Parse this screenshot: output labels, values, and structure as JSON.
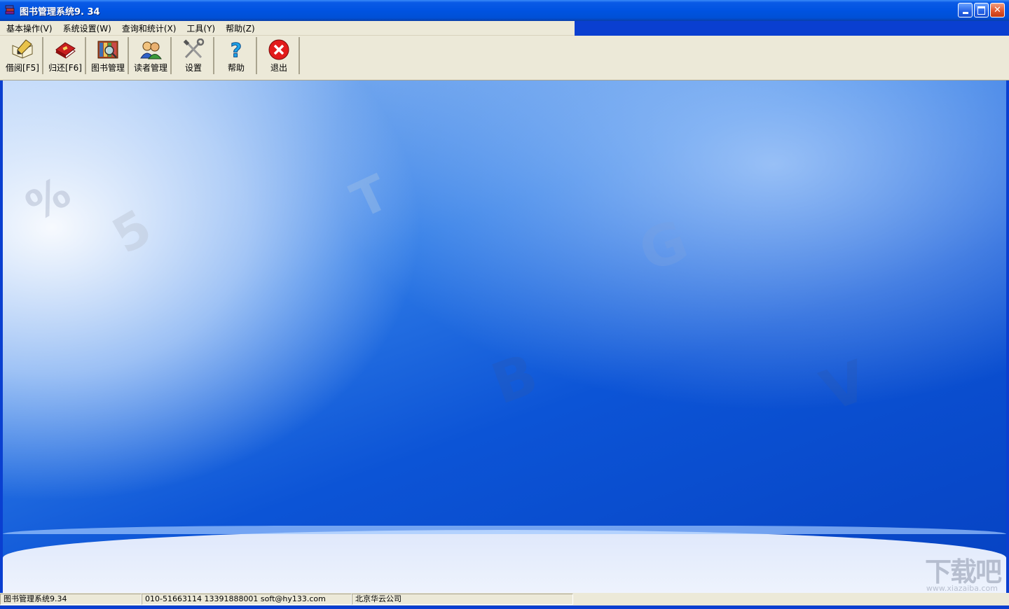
{
  "window": {
    "title": "图书管理系统9. 34",
    "app_icon": "book-stack-icon",
    "controls": {
      "minimize": "_",
      "maximize": "□",
      "close": "✕"
    }
  },
  "menu": {
    "items": [
      {
        "label": "基本操作(V)"
      },
      {
        "label": "系统设置(W)"
      },
      {
        "label": "查询和统计(X)"
      },
      {
        "label": "工具(Y)"
      },
      {
        "label": "帮助(Z)"
      }
    ]
  },
  "toolbar": {
    "buttons": [
      {
        "label": "借阅[F5]",
        "icon": "borrow-book-icon"
      },
      {
        "label": "归还[F6]",
        "icon": "return-book-icon"
      },
      {
        "label": "图书管理",
        "icon": "book-management-icon"
      },
      {
        "label": "读者管理",
        "icon": "reader-management-icon"
      },
      {
        "label": "设置",
        "icon": "settings-tools-icon"
      },
      {
        "label": "帮助",
        "icon": "help-icon"
      },
      {
        "label": "退出",
        "icon": "exit-icon"
      }
    ]
  },
  "background": {
    "watermark": "下载吧",
    "watermark_url": "www.xiazaiba.com"
  },
  "status": {
    "app_version": "图书管理系统9.34",
    "contact": "010-51663114  13391888001 soft@hy133.com",
    "company": "北京华云公司"
  },
  "colors": {
    "titlebar": "#0053e1",
    "chrome": "#ece9d8",
    "close_button": "#e2562c",
    "desktop_blue": "#0a3fd0"
  }
}
